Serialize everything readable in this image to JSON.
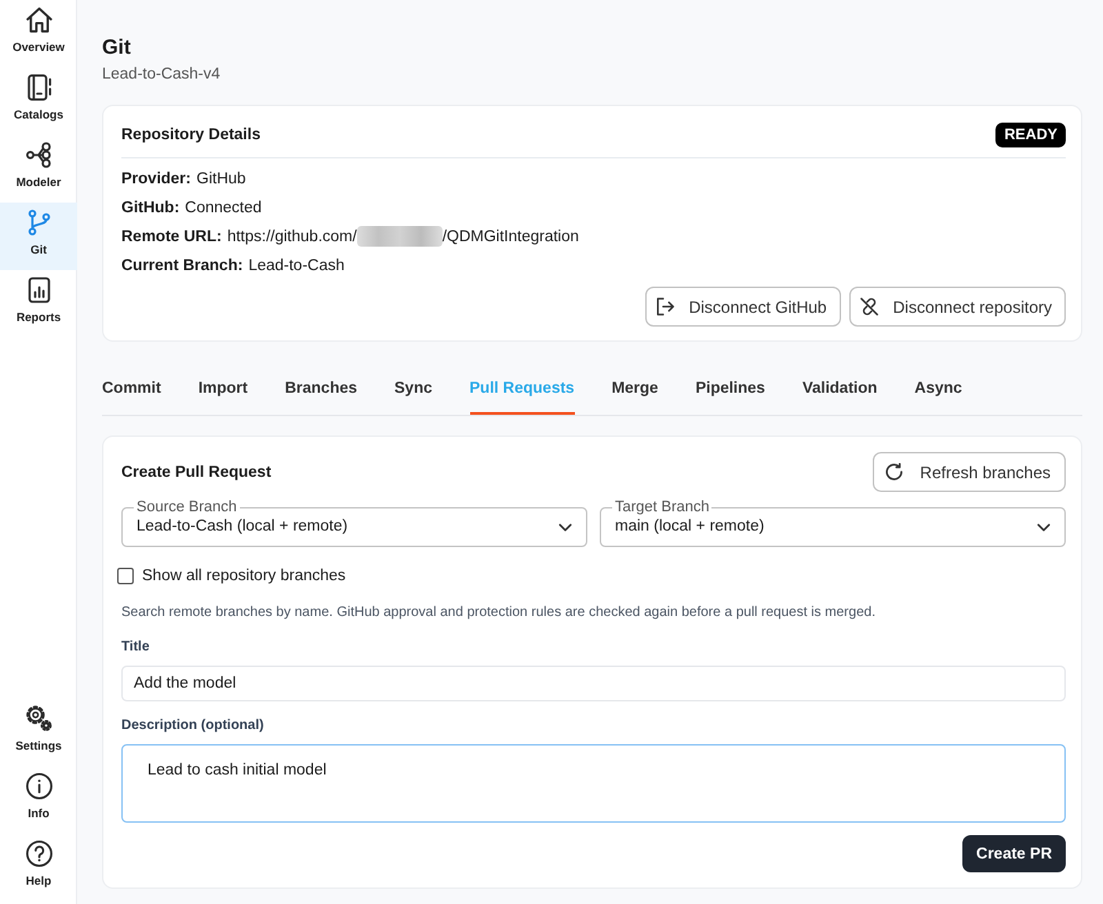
{
  "sidebar": {
    "items": [
      {
        "label": "Overview",
        "selected": false
      },
      {
        "label": "Catalogs",
        "selected": false
      },
      {
        "label": "Modeler",
        "selected": false
      },
      {
        "label": "Git",
        "selected": true
      },
      {
        "label": "Reports",
        "selected": false
      }
    ],
    "footer_items": [
      {
        "label": "Settings",
        "selected": false
      },
      {
        "label": "Info",
        "selected": false
      },
      {
        "label": "Help",
        "selected": false
      }
    ]
  },
  "page": {
    "title": "Git",
    "subtitle": "Lead-to-Cash-v4"
  },
  "repository_card": {
    "title": "Repository Details",
    "status_badge": "READY",
    "details": [
      {
        "label": "Provider:",
        "value": "GitHub",
        "redacted": false
      },
      {
        "label": "GitHub:",
        "value": "Connected",
        "redacted": false
      },
      {
        "label": "Remote URL:",
        "value": "https://github.com/",
        "redacted": true,
        "value_end": "/QDMGitIntegration"
      },
      {
        "label": "Current Branch:",
        "value": "Lead-to-Cash",
        "redacted": false
      }
    ],
    "buttons": [
      {
        "label": "Disconnect GitHub"
      },
      {
        "label": "Disconnect repository"
      }
    ]
  },
  "tabs": [
    {
      "label": "Commit",
      "selected": false
    },
    {
      "label": "Import",
      "selected": false
    },
    {
      "label": "Branches",
      "selected": false
    },
    {
      "label": "Sync",
      "selected": false
    },
    {
      "label": "Pull Requests",
      "selected": true
    },
    {
      "label": "Merge",
      "selected": false
    },
    {
      "label": "Pipelines",
      "selected": false
    },
    {
      "label": "Validation",
      "selected": false
    },
    {
      "label": "Async",
      "selected": false
    }
  ],
  "pull_request_form": {
    "title": "Create Pull Request",
    "refresh_button": "Refresh branches",
    "source_branch": {
      "label": "Source Branch",
      "value": "Lead-to-Cash (local + remote)"
    },
    "target_branch": {
      "label": "Target Branch",
      "value": "main (local + remote)"
    },
    "show_all_branches": {
      "label": "Show all repository branches",
      "checked": false
    },
    "help_text": "Search remote branches by name. GitHub approval and protection rules are checked again before a pull request is merged.",
    "title_field": {
      "label": "Title",
      "value": "Add the model"
    },
    "description_field": {
      "label": "Description (optional)",
      "value": "Lead to cash initial model",
      "focused": true
    },
    "submit_button": "Create PR"
  }
}
